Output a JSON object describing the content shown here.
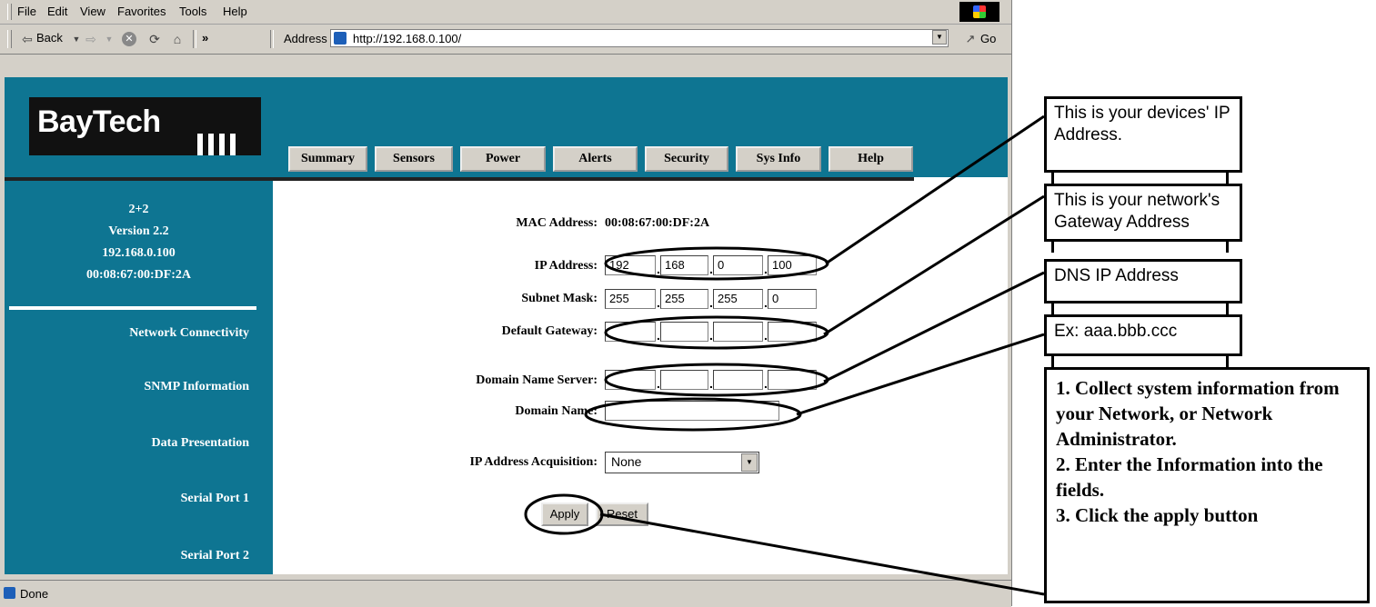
{
  "browser": {
    "menu": [
      "File",
      "Edit",
      "View",
      "Favorites",
      "Tools",
      "Help"
    ],
    "toolbar": {
      "back_label": "Back",
      "more_label": "»",
      "address_label": "Address",
      "url": "http://192.168.0.100/",
      "go_label": "Go"
    },
    "status": "Done"
  },
  "app": {
    "logo_text": "BayTech",
    "tabs": [
      "Summary",
      "Sensors",
      "Power",
      "Alerts",
      "Security",
      "Sys Info",
      "Help"
    ],
    "device": {
      "model": "2+2",
      "version": "Version 2.2",
      "ip": "192.168.0.100",
      "mac": "00:08:67:00:DF:2A"
    },
    "sidebar_links": [
      "Network Connectivity",
      "SNMP Information",
      "Data Presentation",
      "Serial Port 1",
      "Serial Port 2"
    ]
  },
  "form": {
    "mac_label": "MAC Address:",
    "mac_value": "00:08:67:00:DF:2A",
    "ip_label": "IP Address:",
    "ip_octets": [
      "192",
      "168",
      "0",
      "100"
    ],
    "subnet_label": "Subnet Mask:",
    "subnet_octets": [
      "255",
      "255",
      "255",
      "0"
    ],
    "gateway_label": "Default Gateway:",
    "gateway_octets": [
      "",
      "",
      "",
      ""
    ],
    "dns_label": "Domain Name Server:",
    "dns_octets": [
      "",
      "",
      "",
      ""
    ],
    "domain_label": "Domain Name:",
    "domain_value": "",
    "acq_label": "IP Address Acquisition:",
    "acq_value": "None",
    "apply_label": "Apply",
    "reset_label": "Reset"
  },
  "annotations": {
    "ip_note": "This is your devices' IP Address.",
    "gateway_note": "This is your network's Gateway Address",
    "dns_note": "DNS IP Address",
    "domain_note": "Ex: aaa.bbb.ccc",
    "instructions": [
      "1. Collect system information from your Network, or Network Administrator.",
      "2. Enter the Information into the fields.",
      "3. Click the apply button"
    ]
  }
}
